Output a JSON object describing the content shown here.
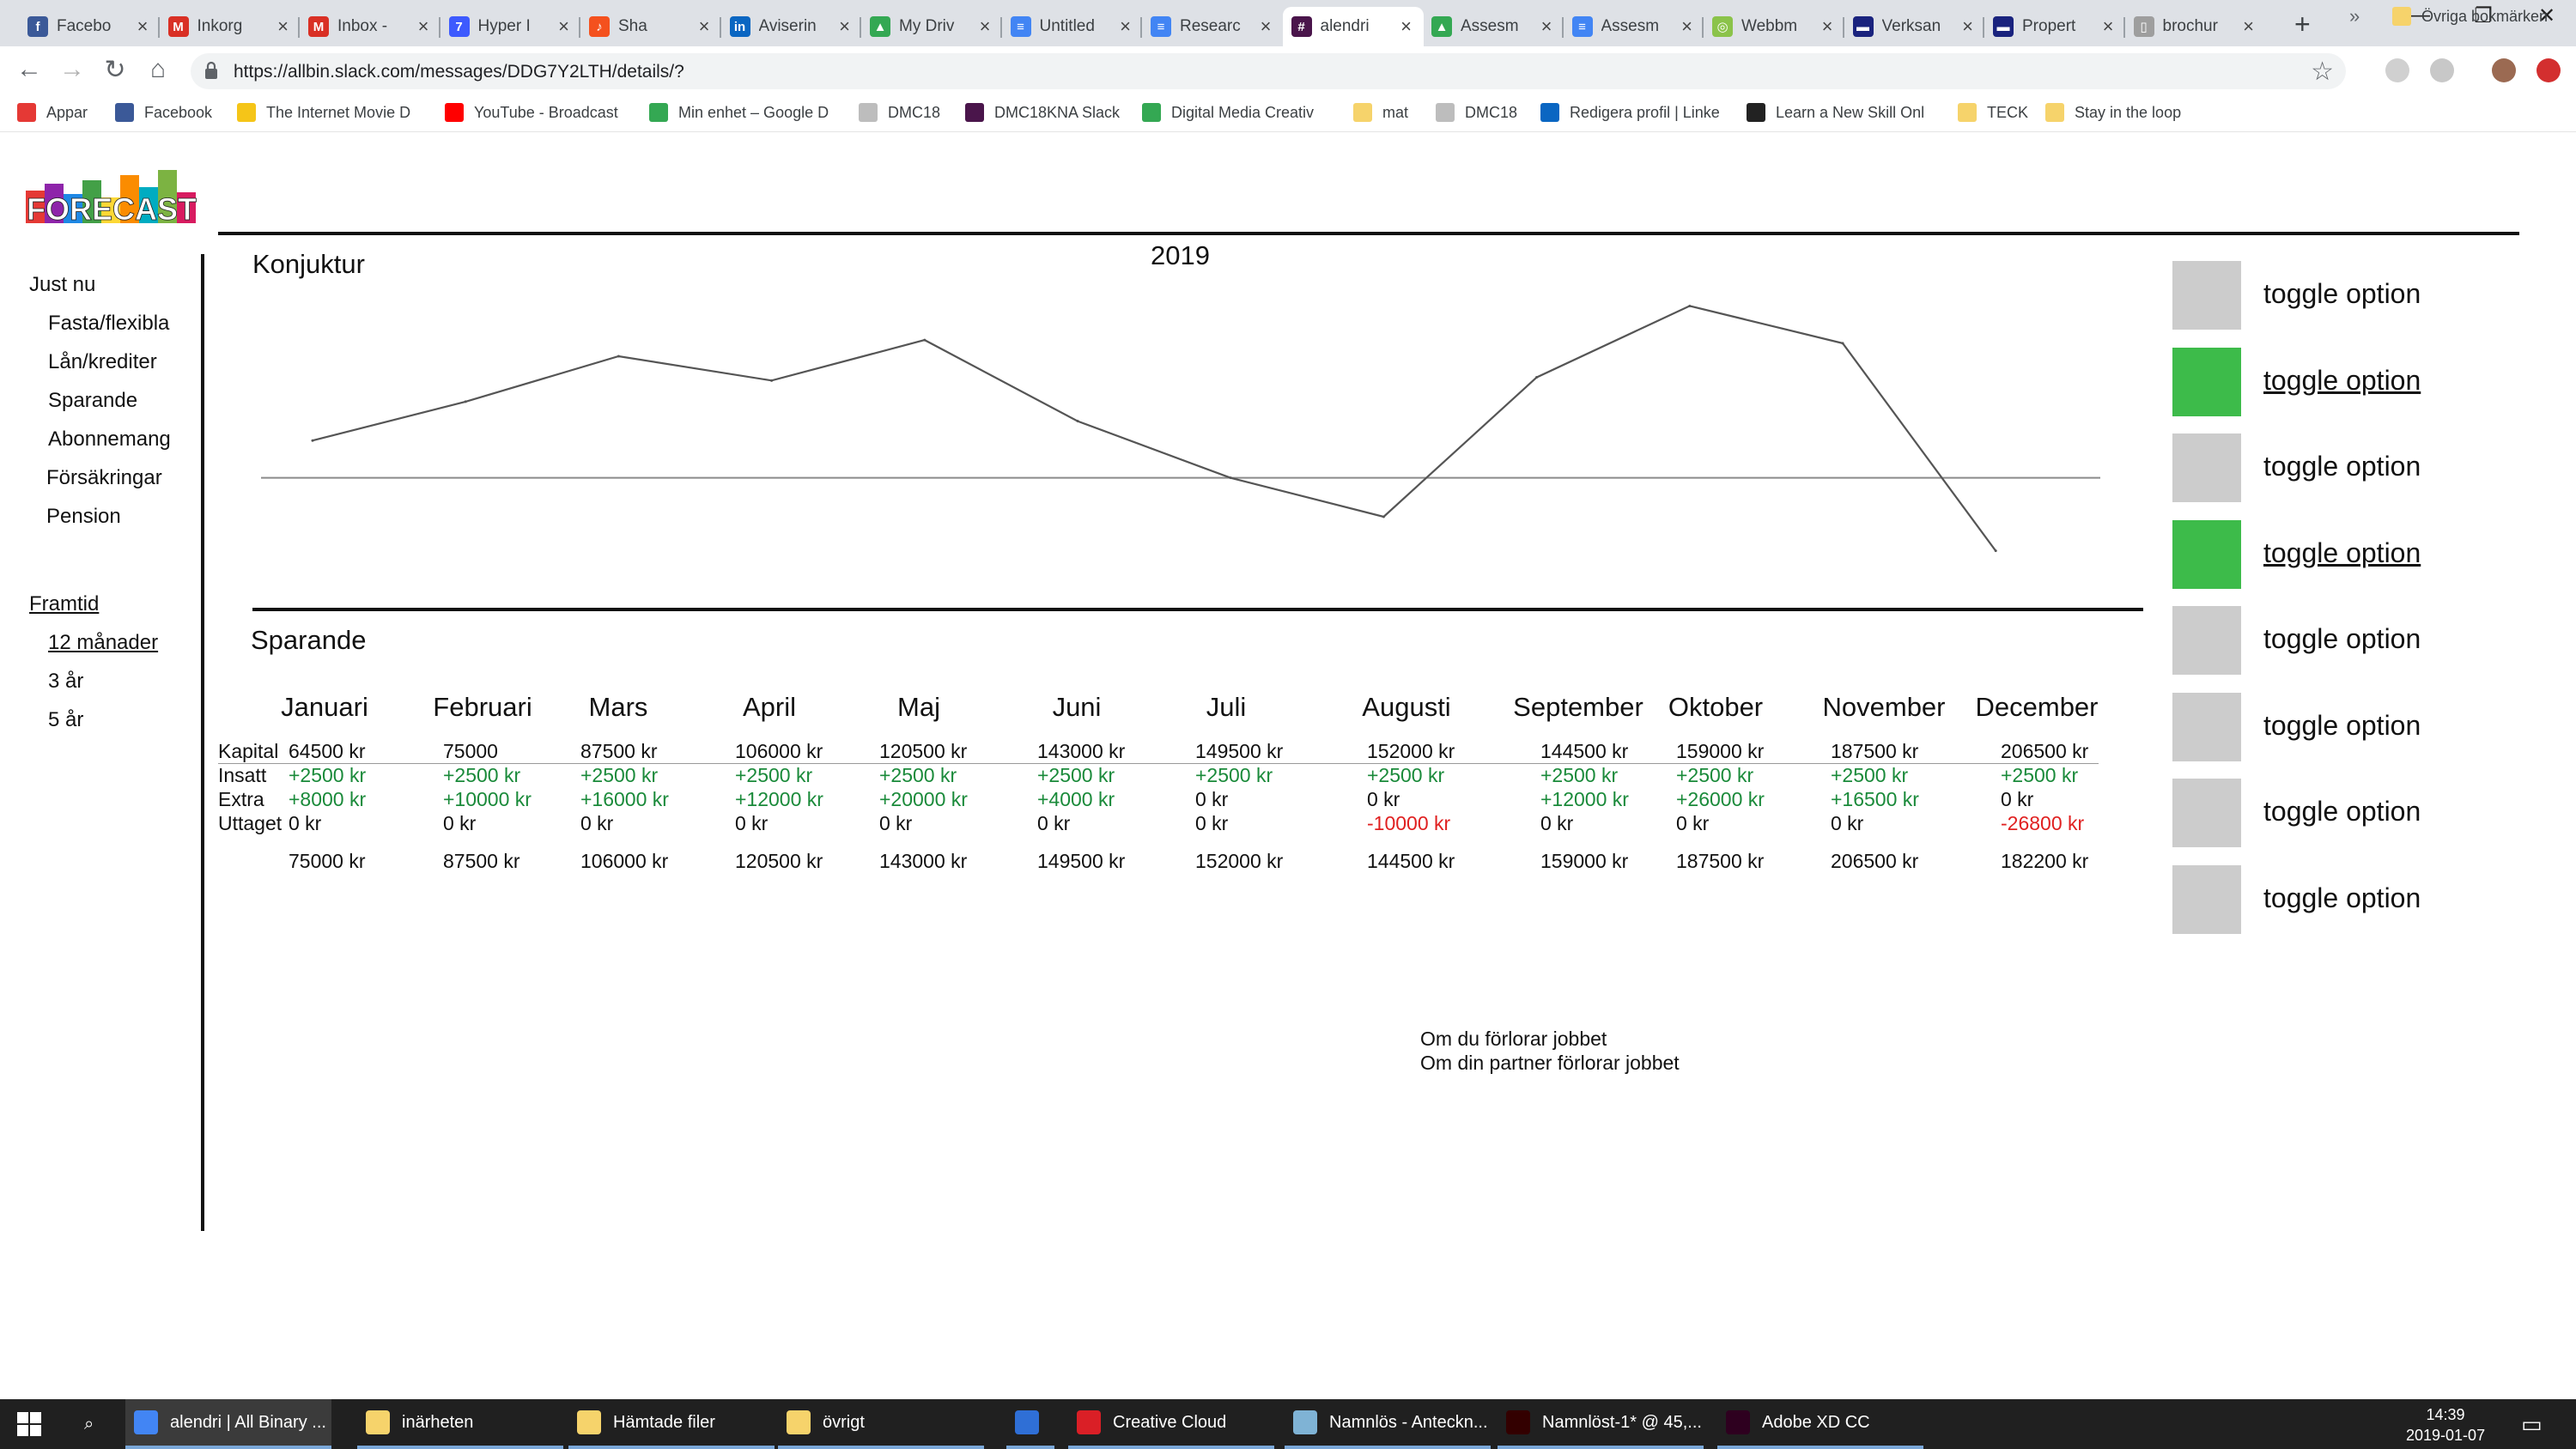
{
  "browser": {
    "tabs": [
      {
        "label": "Facebo",
        "icon": "facebook-icon",
        "color": "#3b5998",
        "glyph": "f"
      },
      {
        "label": "Inkorg",
        "icon": "gmail-icon",
        "color": "#d93025",
        "glyph": "M"
      },
      {
        "label": "Inbox -",
        "icon": "gmail-icon",
        "color": "#d93025",
        "glyph": "M"
      },
      {
        "label": "Hyper I",
        "icon": "hyper-icon",
        "color": "#3d5afe",
        "glyph": "7"
      },
      {
        "label": "Sha",
        "icon": "shazam-icon",
        "color": "#f4511e",
        "glyph": "♪"
      },
      {
        "label": "Aviserin",
        "icon": "linkedin-icon",
        "color": "#0a66c2",
        "glyph": "in"
      },
      {
        "label": "My Driv",
        "icon": "drive-icon",
        "color": "#34a853",
        "glyph": "▲"
      },
      {
        "label": "Untitled",
        "icon": "docs-icon",
        "color": "#4285f4",
        "glyph": "≡"
      },
      {
        "label": "Researc",
        "icon": "docs-icon",
        "color": "#4285f4",
        "glyph": "≡"
      },
      {
        "label": "alendri",
        "icon": "slack-icon",
        "color": "#4a154b",
        "glyph": "#"
      },
      {
        "label": "Assesm",
        "icon": "drive-icon",
        "color": "#34a853",
        "glyph": "▲"
      },
      {
        "label": "Assesm",
        "icon": "docs-icon",
        "color": "#4285f4",
        "glyph": "≡"
      },
      {
        "label": "Webbm",
        "icon": "web-icon",
        "color": "#8bc34a",
        "glyph": "◎"
      },
      {
        "label": "Verksan",
        "icon": "page-icon",
        "color": "#1a237e",
        "glyph": "▬"
      },
      {
        "label": "Propert",
        "icon": "page-icon",
        "color": "#1a237e",
        "glyph": "▬"
      },
      {
        "label": "brochur",
        "icon": "file-icon",
        "color": "#9e9e9e",
        "glyph": "▯"
      }
    ],
    "url": "https://allbin.slack.com/messages/DDG7Y2LTH/details/?",
    "bookmarks": [
      {
        "label": "Appar",
        "icon": "apps-icon",
        "color": "#e53935"
      },
      {
        "label": "Facebook",
        "icon": "facebook-icon",
        "color": "#3b5998"
      },
      {
        "label": "The Internet Movie D",
        "icon": "imdb-icon",
        "color": "#f5c518"
      },
      {
        "label": "YouTube - Broadcast",
        "icon": "youtube-icon",
        "color": "#ff0000"
      },
      {
        "label": "Min enhet – Google D",
        "icon": "drive-icon",
        "color": "#34a853"
      },
      {
        "label": "DMC18",
        "icon": "file-icon",
        "color": "#bdbdbd"
      },
      {
        "label": "DMC18KNA Slack",
        "icon": "slack-icon",
        "color": "#4a154b"
      },
      {
        "label": "Digital Media Creativ",
        "icon": "drive-icon",
        "color": "#34a853"
      },
      {
        "label": "mat",
        "icon": "folder-icon",
        "color": "#f6d36b"
      },
      {
        "label": "DMC18",
        "icon": "file-icon",
        "color": "#bdbdbd"
      },
      {
        "label": "Redigera profil | Linke",
        "icon": "linkedin-icon",
        "color": "#0a66c2"
      },
      {
        "label": "Learn a New Skill Onl",
        "icon": "skillshare-icon",
        "color": "#222222"
      },
      {
        "label": "TECK",
        "icon": "folder-icon",
        "color": "#f6d36b"
      },
      {
        "label": "Stay in the loop",
        "icon": "folder-icon",
        "color": "#f6d36b"
      }
    ],
    "bookmarks_more": "»",
    "other_bookmarks": "Övriga bokmärken"
  },
  "app": {
    "logo_text": "FORECAST",
    "sidebar": {
      "now_heading": "Just nu",
      "now_items": [
        "Fasta/flexibla",
        "Lån/krediter",
        "Sparande",
        "Abonnemang",
        "Försäkringar",
        "Pension"
      ],
      "future_heading": "Framtid",
      "future_items": [
        "12 månader",
        "3 år",
        "5 år"
      ]
    },
    "chart_title": "Konjuktur",
    "chart_year": "2019",
    "savings_title": "Sparande",
    "toggles": [
      {
        "label": "toggle option",
        "on": false
      },
      {
        "label": "toggle option",
        "on": true
      },
      {
        "label": "toggle option",
        "on": false
      },
      {
        "label": "toggle option",
        "on": true
      },
      {
        "label": "toggle option",
        "on": false
      },
      {
        "label": "toggle option",
        "on": false
      },
      {
        "label": "toggle option",
        "on": false
      },
      {
        "label": "toggle option",
        "on": false
      }
    ],
    "scenarios": [
      "Om du förlorar jobbet",
      "Om din partner förlorar jobbet"
    ]
  },
  "chart_data": {
    "type": "line",
    "title": "2019",
    "categories": [
      "Januari",
      "Februari",
      "Mars",
      "April",
      "Maj",
      "Juni",
      "Juli",
      "Augusti",
      "September",
      "Oktober",
      "November",
      "December"
    ],
    "series": [
      {
        "values": [
          0.23,
          0.47,
          0.75,
          0.6,
          0.85,
          0.35,
          0.0,
          -0.24,
          0.62,
          1.06,
          0.83,
          -0.45
        ]
      }
    ],
    "baseline": 0,
    "ylim": [
      -0.6,
      1.2
    ],
    "grid": false,
    "legend": "none"
  },
  "savings_table": {
    "months": [
      "Januari",
      "Februari",
      "Mars",
      "April",
      "Maj",
      "Juni",
      "Juli",
      "Augusti",
      "September",
      "Oktober",
      "November",
      "December"
    ],
    "row_labels": [
      "Kapital",
      "Insatt",
      "Extra",
      "Uttaget"
    ],
    "kapital": [
      "64500 kr",
      "75000",
      "87500 kr",
      "106000 kr",
      "120500 kr",
      "143000 kr",
      "149500 kr",
      "152000 kr",
      "144500 kr",
      "159000 kr",
      "187500 kr",
      "206500 kr"
    ],
    "insatt": [
      "+2500 kr",
      "+2500 kr",
      "+2500 kr",
      "+2500 kr",
      "+2500 kr",
      "+2500 kr",
      "+2500 kr",
      "+2500 kr",
      "+2500 kr",
      "+2500 kr",
      "+2500 kr",
      "+2500 kr"
    ],
    "extra": [
      "+8000 kr",
      "+10000 kr",
      "+16000 kr",
      "+12000 kr",
      "+20000 kr",
      "+4000 kr",
      "0 kr",
      "0 kr",
      "+12000 kr",
      "+26000 kr",
      "+16500 kr",
      "0 kr"
    ],
    "uttaget": [
      "0 kr",
      "0 kr",
      "0 kr",
      "0 kr",
      "0 kr",
      "0 kr",
      "0 kr",
      "-10000 kr",
      "0 kr",
      "0 kr",
      "0 kr",
      "-26800 kr"
    ],
    "totals": [
      "75000 kr",
      "87500 kr",
      "106000 kr",
      "120500 kr",
      "143000 kr",
      "149500 kr",
      "152000 kr",
      "144500 kr",
      "159000 kr",
      "187500 kr",
      "206500 kr",
      "182200 kr"
    ],
    "positive_color": "#1a8a3a",
    "negative_color": "#e02020"
  },
  "taskbar": {
    "items": [
      {
        "label": "alendri | All Binary ...",
        "icon": "chrome-icon",
        "color": "#4285f4"
      },
      {
        "label": "inärheten",
        "icon": "folder-icon",
        "color": "#f6d36b"
      },
      {
        "label": "Hämtade filer",
        "icon": "folder-icon",
        "color": "#f6d36b"
      },
      {
        "label": "övrigt",
        "icon": "folder-icon",
        "color": "#f6d36b"
      },
      {
        "label": "",
        "icon": "mail-icon",
        "color": "#2f6fd6"
      },
      {
        "label": "Creative Cloud",
        "icon": "creative-cloud-icon",
        "color": "#da1f26"
      },
      {
        "label": "Namnlös - Anteckn...",
        "icon": "notepad-icon",
        "color": "#7fb3d5"
      },
      {
        "label": "Namnlöst-1* @ 45,...",
        "icon": "illustrator-icon",
        "color": "#330000"
      },
      {
        "label": "Adobe XD CC",
        "icon": "xd-icon",
        "color": "#2e001f"
      }
    ],
    "time": "14:39",
    "date": "2019-01-07"
  }
}
